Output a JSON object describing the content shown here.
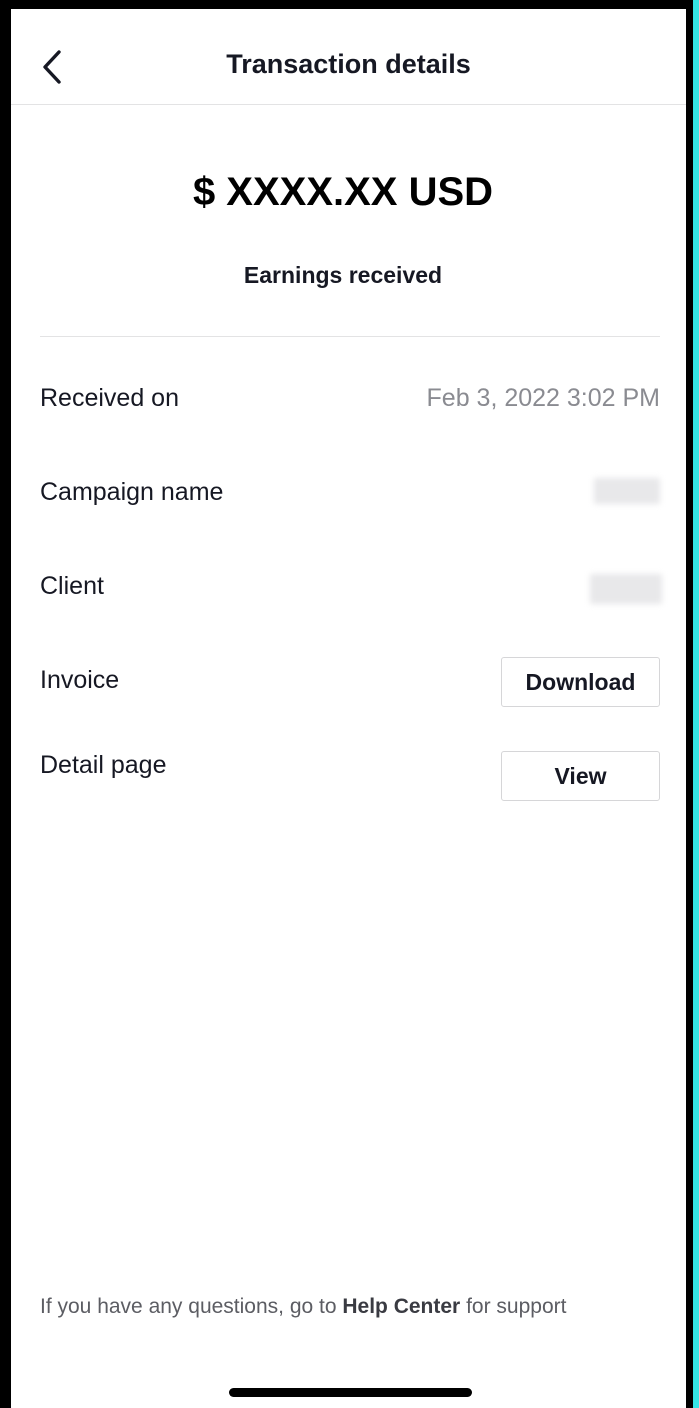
{
  "header": {
    "title": "Transaction details",
    "back_icon": "chevron-left-icon"
  },
  "summary": {
    "amount": "$ XXXX.XX USD",
    "caption": "Earnings received"
  },
  "details": {
    "received_on": {
      "label": "Received on",
      "value": "Feb 3, 2022 3:02 PM"
    },
    "campaign_name": {
      "label": "Campaign name"
    },
    "client": {
      "label": "Client"
    },
    "invoice": {
      "label": "Invoice",
      "button": "Download"
    },
    "detail_page": {
      "label": "Detail page",
      "button": "View"
    }
  },
  "footer": {
    "prefix": "If you have any questions, go to ",
    "link": "Help Center",
    "suffix": " for support"
  },
  "colors": {
    "frame_border": "#000000",
    "accent_strip": "#35e6e6",
    "text_primary": "#161823",
    "text_secondary": "#8a8b91",
    "divider": "#e3e3e4"
  }
}
